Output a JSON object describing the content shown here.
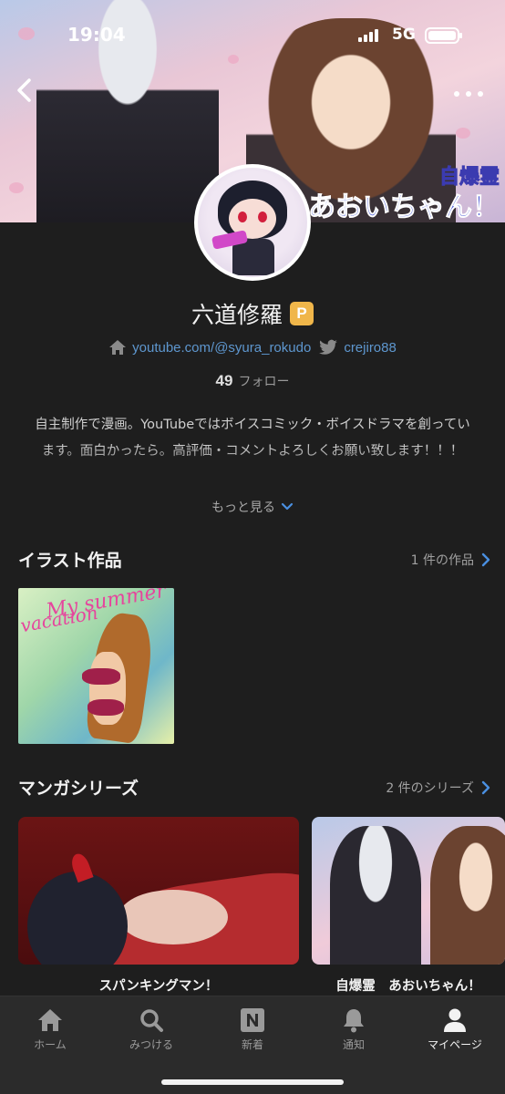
{
  "status_bar": {
    "time": "19:04",
    "network": "5G"
  },
  "banner": {
    "logo_line1": "自爆霊",
    "logo_line2": "あおいちゃん！"
  },
  "profile": {
    "name": "六道修羅",
    "badge": "P",
    "links": [
      {
        "text": "youtube.com/@syura_rokudo",
        "icon": "home-icon"
      },
      {
        "text": "crejiro88",
        "icon": "twitter-bird-icon"
      }
    ],
    "follow_count": "49",
    "follow_label": "フォロー",
    "bio": "自主制作で漫画。YouTubeではボイスコミック・ボイスドラマを創っています。面白かったら。高評価・コメントよろしくお願い致します！！！",
    "more_label": "もっと見る"
  },
  "sections": {
    "illust": {
      "title": "イラスト作品",
      "count_label": "1 件の作品",
      "items": [
        {
          "caption_line1": "My summer",
          "caption_line2": "vacation"
        }
      ]
    },
    "manga": {
      "title": "マンガシリーズ",
      "count_label": "2 件のシリーズ",
      "items": [
        {
          "title": "スパンキングマン！"
        },
        {
          "title": "自爆霊　あおいちゃん！"
        }
      ]
    }
  },
  "tabbar": [
    {
      "label": "ホーム",
      "icon": "home-icon"
    },
    {
      "label": "みつける",
      "icon": "search-icon"
    },
    {
      "label": "新着",
      "icon": "new-n-icon"
    },
    {
      "label": "通知",
      "icon": "bell-icon"
    },
    {
      "label": "マイページ",
      "icon": "person-icon",
      "active": true
    }
  ],
  "colors": {
    "background": "#1e1e1e",
    "link": "#5e97cf",
    "badge": "#f0b64a",
    "accent": "#4a8fe0"
  }
}
